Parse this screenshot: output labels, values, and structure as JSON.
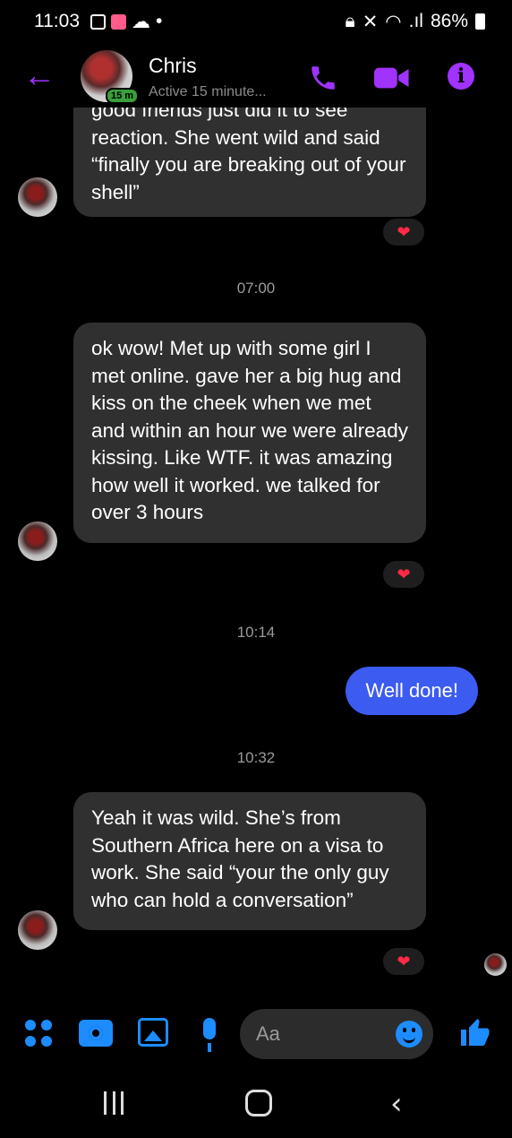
{
  "status_bar": {
    "time": "11:03",
    "battery": "86%"
  },
  "header": {
    "back_icon": "arrow-left-icon",
    "contact_name": "Chris",
    "active_badge": "15 m",
    "active_status": "Active 15 minute...",
    "accent_color": "#a033ff"
  },
  "messages": [
    {
      "type": "incoming",
      "text": "good friends just did it to see reaction. She went wild and said “finally you are breaking out of your shell”",
      "reaction": "❤"
    },
    {
      "type": "timestamp",
      "text": "07:00"
    },
    {
      "type": "incoming",
      "text": "ok wow! Met up with some girl I met online. gave her a big hug and kiss on the cheek when we met and within an hour we were already kissing. Like WTF. it was amazing how well it worked. we talked for over 3 hours",
      "reaction": "❤"
    },
    {
      "type": "timestamp",
      "text": "10:14"
    },
    {
      "type": "outgoing",
      "text": "Well done!"
    },
    {
      "type": "timestamp",
      "text": "10:32"
    },
    {
      "type": "incoming",
      "text": "Yeah it was wild. She’s from Southern Africa here on a visa to work. She said “your the only guy who can hold a conversation”",
      "reaction": "❤"
    }
  ],
  "composer": {
    "placeholder": "Aa",
    "icons": [
      "menu-dots-icon",
      "camera-icon",
      "gallery-icon",
      "microphone-icon",
      "emoji-icon",
      "thumbs-up-icon"
    ],
    "icon_color": "#1d8cff"
  },
  "colors": {
    "incoming_bubble": "#303030",
    "outgoing_bubble": "#3c5bf0",
    "background": "#000000"
  }
}
